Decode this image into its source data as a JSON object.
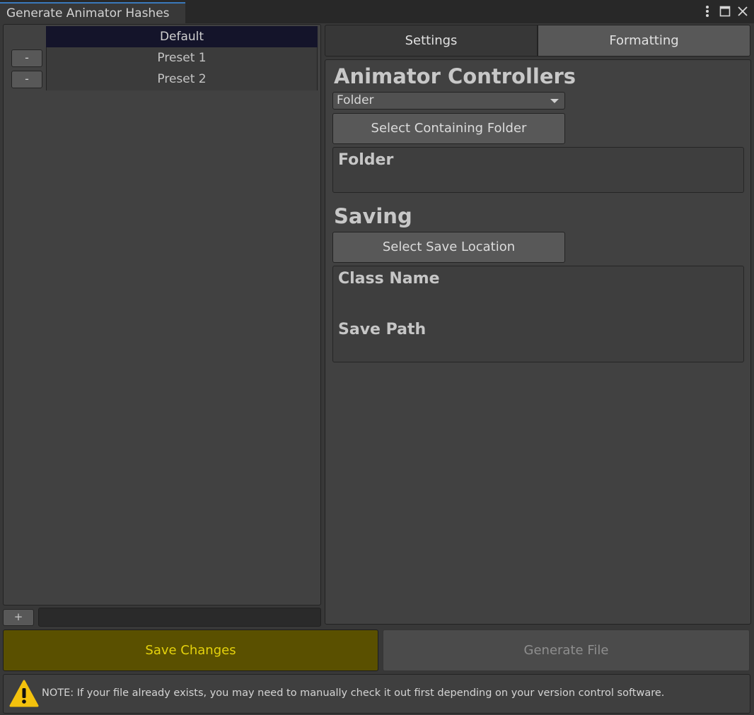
{
  "window": {
    "tab_title": "Generate Animator Hashes",
    "icons": [
      "more-options-icon",
      "maximize-icon",
      "close-icon"
    ]
  },
  "presets": {
    "items": [
      {
        "label": "Default",
        "selected": true,
        "removable": false
      },
      {
        "label": "Preset 1",
        "selected": false,
        "removable": true
      },
      {
        "label": "Preset 2",
        "selected": false,
        "removable": true
      }
    ],
    "remove_label": "-",
    "add_label": "+",
    "new_preset_name": ""
  },
  "tabs": {
    "settings": "Settings",
    "formatting": "Formatting",
    "active": "Settings"
  },
  "settings": {
    "animator_heading": "Animator Controllers",
    "source_dropdown_value": "Folder",
    "select_folder_label": "Select Containing Folder",
    "folder_label": "Folder",
    "saving_heading": "Saving",
    "select_save_label": "Select Save Location",
    "class_name_label": "Class Name",
    "save_path_label": "Save Path"
  },
  "actions": {
    "save_label": "Save Changes",
    "generate_label": "Generate File"
  },
  "note": {
    "icon": "warning-icon",
    "text": "NOTE: If your file already exists, you may need to manually check it out first depending on your version control software."
  },
  "colors": {
    "save_bg": "#5a5000",
    "save_text": "#e5d20c",
    "selected_row": "#14142a",
    "tab_accent": "#3a79bb",
    "warning": "#f4c20d"
  }
}
